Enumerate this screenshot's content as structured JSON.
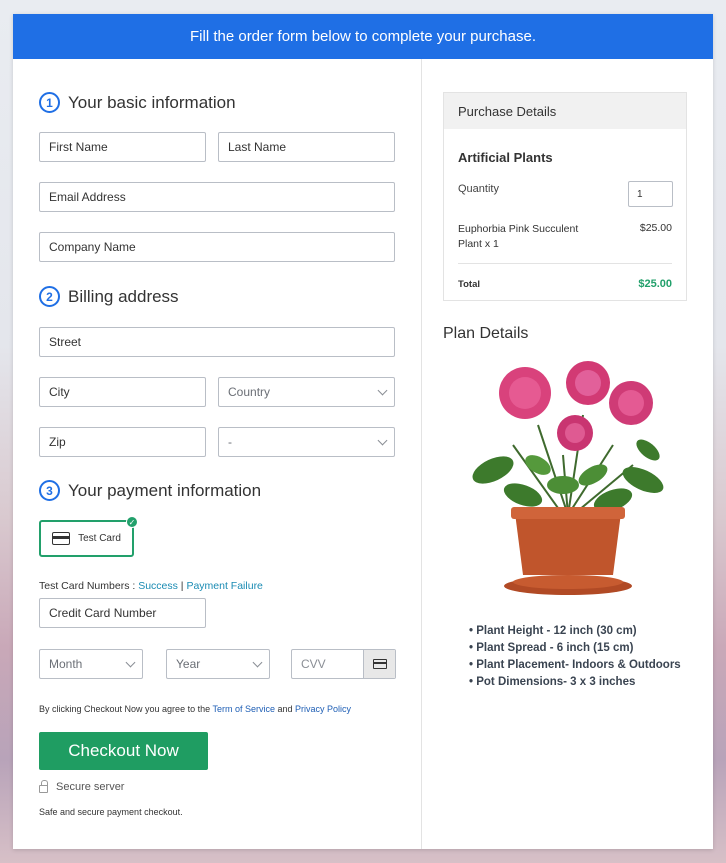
{
  "banner": {
    "text": "Fill the order form below to complete your purchase."
  },
  "basic": {
    "step": "1",
    "title": "Your basic information",
    "first_name": "First Name",
    "last_name": "Last Name",
    "email": "Email Address",
    "company": "Company Name"
  },
  "billing": {
    "step": "2",
    "title": "Billing address",
    "street": "Street",
    "city": "City",
    "country": "Country",
    "zip": "Zip",
    "state": "-"
  },
  "payment": {
    "step": "3",
    "title": "Your payment information",
    "card_option": "Test Card",
    "test_numbers_label": "Test Card Numbers : ",
    "success": "Success",
    "separator": " | ",
    "failure": "Payment Failure",
    "card_number": "Credit Card Number",
    "month": "Month",
    "year": "Year",
    "cvv": "CVV",
    "agree_prefix": "By clicking Checkout Now you agree to the ",
    "terms": "Term of Service",
    "and": " and ",
    "privacy": "Privacy Policy",
    "checkout": "Checkout Now",
    "secure": "Secure server",
    "safe": "Safe and secure payment checkout."
  },
  "purchase": {
    "header": "Purchase Details",
    "product": "Artificial Plants",
    "quantity_label": "Quantity",
    "quantity": "1",
    "item": "Euphorbia Pink Succulent Plant x 1",
    "price": "$25.00",
    "total_label": "Total",
    "total": "$25.00"
  },
  "plan": {
    "title": "Plan Details",
    "features": [
      "Plant Height - 12 inch (30 cm)",
      "Plant Spread - 6 inch (15 cm)",
      "Plant Placement- Indoors & Outdoors",
      "Pot Dimensions- 3 x 3 inches"
    ]
  },
  "colors": {
    "banner": "#1f6fe5",
    "accent_green": "#1f9d62",
    "link": "#1a8bb3"
  }
}
